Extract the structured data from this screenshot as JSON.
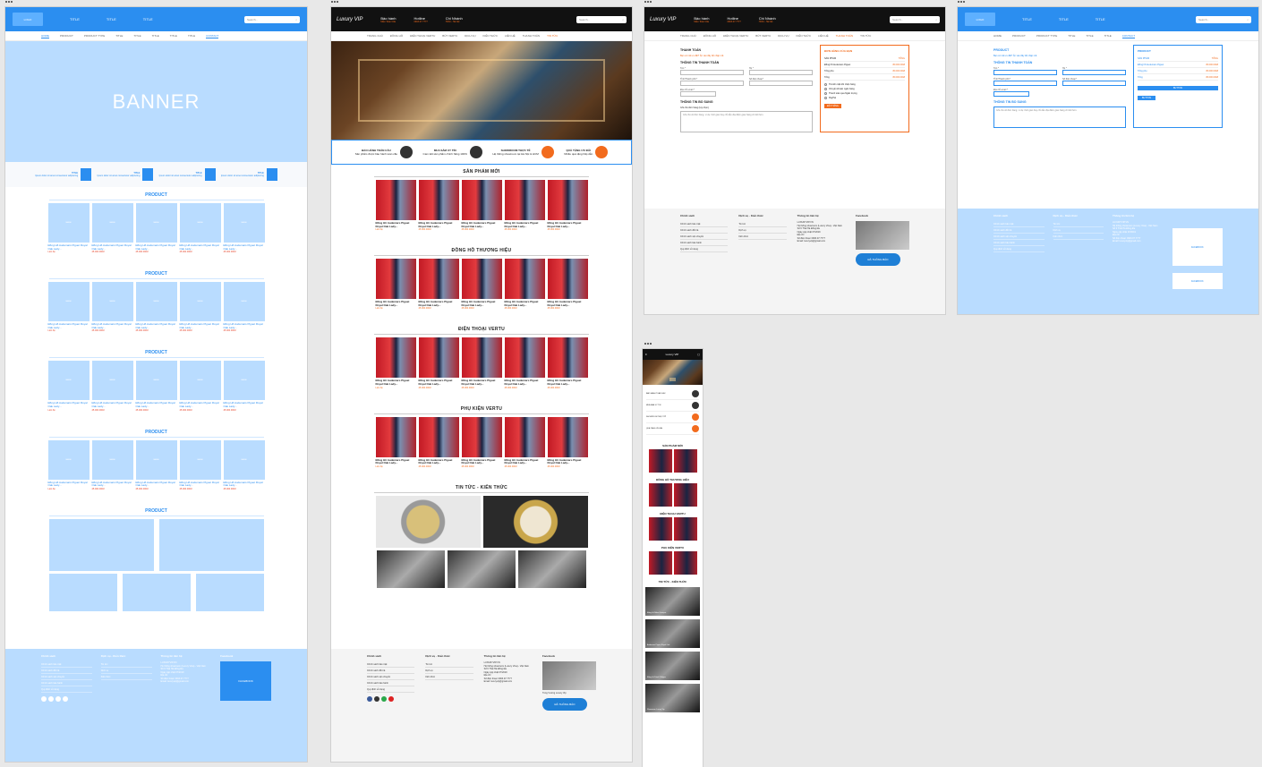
{
  "wireframe": {
    "logo": "LOGO",
    "top_items": [
      "TITLE",
      "TITLE",
      "TITLE"
    ],
    "search_placeholder": "Search...",
    "nav": [
      "HOME",
      "PRODUCT",
      "PRODUCT TYPE",
      "TITLE",
      "TITLE",
      "TITLE",
      "TITLE",
      "TITLE",
      "CONTACT"
    ],
    "banner": "BANNER",
    "features": [
      {
        "title": "TITLE",
        "sub": "Ipsum dolor sit amet consectetur adipiscing"
      },
      {
        "title": "TITLE",
        "sub": "Ipsum dolor sit amet consectetur adipiscing"
      },
      {
        "title": "TITLE",
        "sub": "Ipsum dolor sit amet consectetur adipiscing"
      },
      {
        "title": "TITLE",
        "sub": "Ipsum dolor sit amet consectetur adipiscing"
      }
    ],
    "section_title": "PRODUCT",
    "product": {
      "img": "IMAGE",
      "name": "Đồng Hồ Audemars Piguet Royal Oak Lady...",
      "price": "45.000.000đ",
      "contact": "Liên hệ"
    },
    "footer": {
      "col1_title": "Chính sách",
      "col1_items": [
        "Chính sách bảo mật",
        "Chính sách đổi trả",
        "Chính sách vận chuyển",
        "Chính sách bảo hành",
        "Quy định sử dụng"
      ],
      "col2_title": "Dịch vụ - Kiến thức",
      "col2_items": [
        "Tin tức",
        "Dịch vụ",
        "Kiến thức"
      ],
      "col3_title": "Thông tin liên hệ",
      "col3_lines": [
        "LUXURYVIP.VN",
        "Hệ thống showroom (Luxury Vina) - Việt Nam",
        "Số 6 Thái Hà Đống Đa",
        "Ngày cập nhật 07/2019",
        "Địa chỉ",
        "Số điện thoại: 0903.07.7777",
        "Email: luxuryvip@gmail.com"
      ],
      "col4_title": "Facebook",
      "fb_box": "FACEBOOK"
    }
  },
  "design": {
    "logo": "Luxury VIP",
    "logo_sub": "Watch & Phone",
    "top_items": [
      {
        "title": "Bảo hành",
        "sub": "Miễn Toàn Cầu"
      },
      {
        "title": "Hotline",
        "sub": "0903.07.7777"
      },
      {
        "title": "Chi Nhánh",
        "sub": "HCM - Hà Nội"
      }
    ],
    "search_placeholder": "Search...",
    "nav": [
      "TRANG CHỦ",
      "ĐỒNG HỒ",
      "ĐIỆN THOẠI VERTU",
      "BÚT VERTU",
      "DỊCH VỤ",
      "KIẾN THỨC",
      "LIÊN HỆ",
      "THANH TOÁN",
      "TIN TỨC"
    ],
    "features": [
      {
        "title": "BẢO HÀNH TOÀN CẦU",
        "sub": "Sản phẩm được bảo hành toàn cầu"
      },
      {
        "title": "MUA SẮM UY TÍN",
        "sub": "Cam kết sản phẩm chính hãng 100%"
      },
      {
        "title": "SHOWROOM THỰC TẾ",
        "sub": "Hệ thống showroom tại Hà Nội & HCM"
      },
      {
        "title": "QUÀ TẶNG ƯU ĐÃI",
        "sub": "Nhiều quà tặng hấp dẫn"
      }
    ],
    "sections": [
      "SẢN PHẨM MỚI",
      "ĐỒNG HỒ THƯƠNG HIỆU",
      "ĐIỆN THOẠI VERTU",
      "PHỤ KIỆN VERTU"
    ],
    "product": {
      "name": "Đồng Hồ Audemars Piguet Royal Oak Lady...",
      "price": "45.000.000đ",
      "contact": "Liên hệ"
    },
    "news_title": "TIN TỨC - KIẾN THỨC",
    "fb_name": "Tùng Vương Luxury Vip",
    "badge": "ĐÃ THÔNG BÁO"
  },
  "checkout": {
    "title": "THANH TOÁN",
    "coupon": "Bạn có mã ưu đãi? Ấn vào đây để nhập mã",
    "billing_title": "THÔNG TIN THANH TOÁN",
    "fields": [
      "Tên *",
      "Họ *",
      "Tỉnh/Thành phố *",
      "Số điện thoại *",
      "Địa chỉ email *"
    ],
    "extra_title": "THÔNG TIN BỔ SUNG",
    "extra_label": "Ghi chú đơn hàng (tuỳ chọn)",
    "notes_placeholder": "Ghi chú về đơn hàng, ví dụ: thời gian hay chỉ dẫn địa điểm giao hàng chi tiết hơn.",
    "order_title": "ĐƠN HÀNG CỦA BẠN",
    "order_lines": [
      {
        "l": "SẢN PHẨM",
        "r": "TỔNG"
      },
      {
        "l": "Đồng hồ Audemars Piguet",
        "r": "45.000.000đ"
      },
      {
        "l": "Tổng phụ",
        "r": "45.000.000đ"
      },
      {
        "l": "Tổng",
        "r": "45.000.000đ"
      }
    ],
    "payments": [
      "Trả tiền mặt khi nhận hàng",
      "Chuyển khoản ngân hàng",
      "Thanh toán qua Ngân lượng",
      "PayPal"
    ],
    "order_button": "ĐẶT HÀNG",
    "wire_title": "PRODUCT",
    "wire_button": "BUTTON"
  },
  "mobile": {
    "logo": "Luxury VIP",
    "sections": [
      "SẢN PHẨM MỚI",
      "ĐỒNG HỒ THƯƠNG HIỆU",
      "ĐIỆN THOẠI VERTU",
      "PHỤ KIỆN VERTU",
      "TIN TỨC - KIẾN THỨC"
    ],
    "news": [
      "Đồng hồ Rolex Datejust",
      "Audemars Piguet Royal Oak",
      "Đồng hồ Patek Philippe",
      "Showroom Luxury Vip"
    ]
  }
}
